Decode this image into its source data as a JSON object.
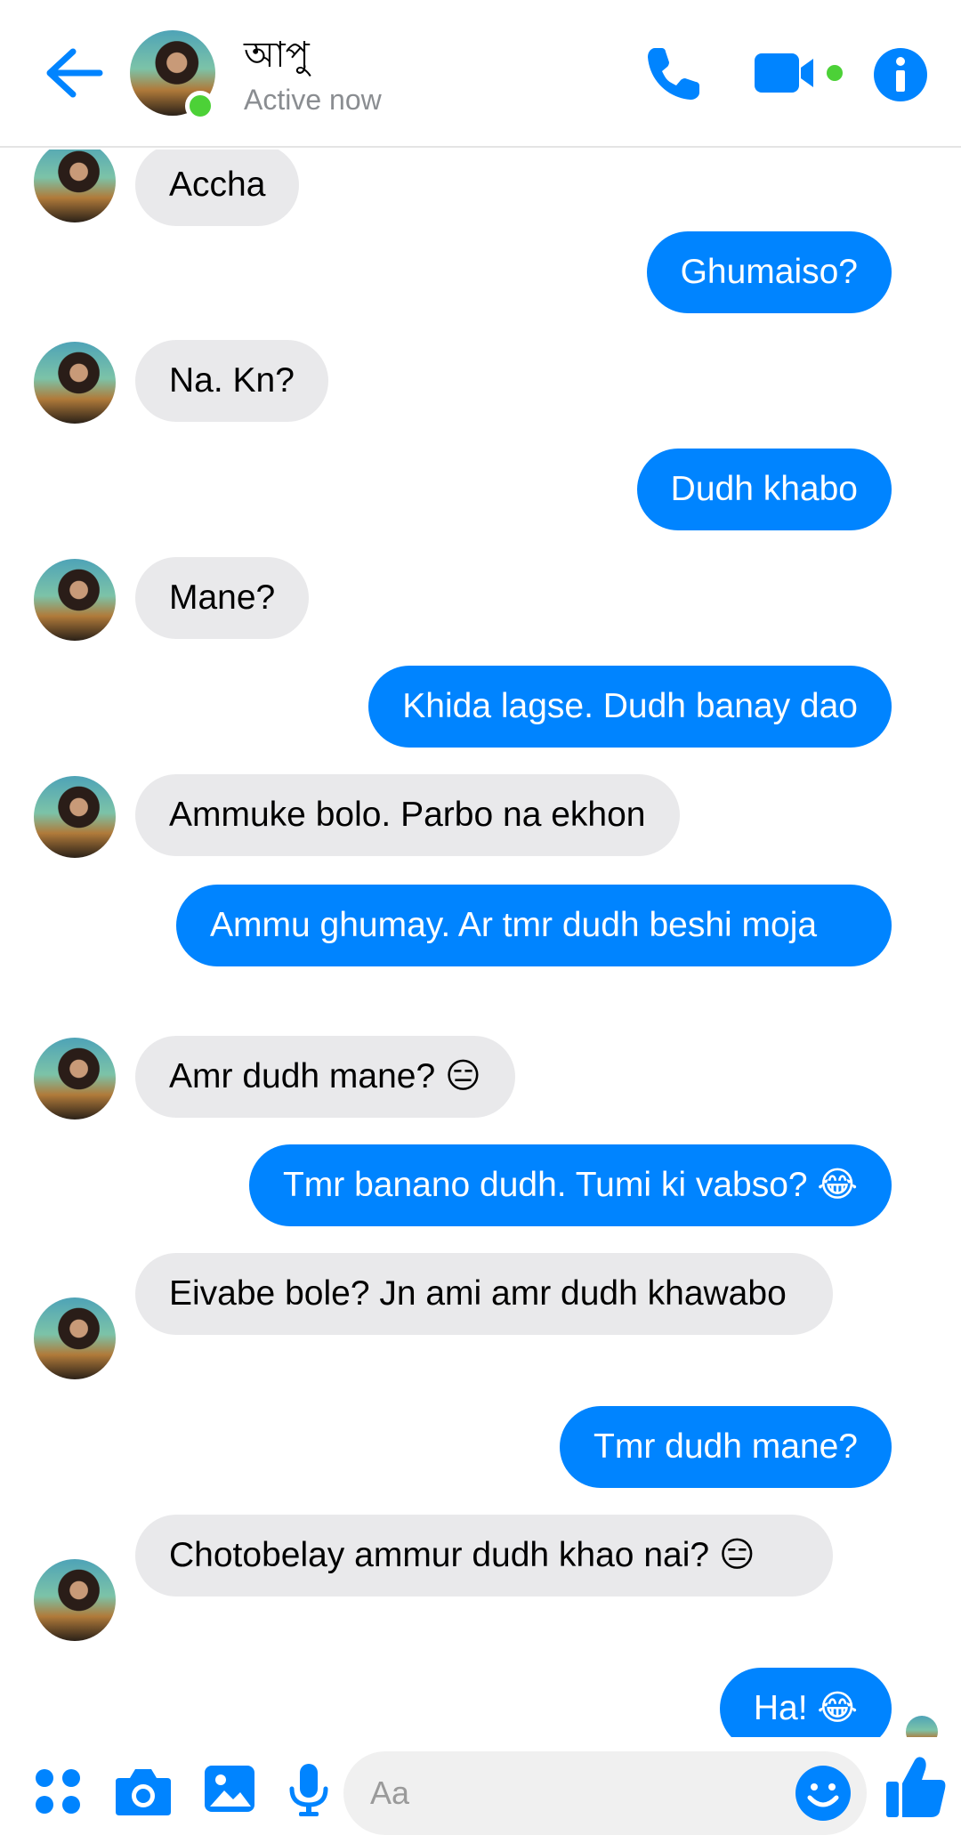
{
  "header": {
    "contact_name": "আপু",
    "status": "Active now"
  },
  "composer": {
    "placeholder": "Aa"
  },
  "messages": [
    {
      "from": "them",
      "text": "Accha"
    },
    {
      "from": "me",
      "text": "Ghumaiso?"
    },
    {
      "from": "them",
      "text": "Na. Kn?"
    },
    {
      "from": "me",
      "text": "Dudh khabo"
    },
    {
      "from": "them",
      "text": "Mane?"
    },
    {
      "from": "me",
      "text": "Khida lagse. Dudh banay dao"
    },
    {
      "from": "them",
      "text": "Ammuke bolo. Parbo na ekhon"
    },
    {
      "from": "me",
      "text": "Ammu ghumay. Ar tmr dudh beshi moja"
    },
    {
      "from": "them",
      "text": "Amr dudh mane? 😑"
    },
    {
      "from": "me",
      "text": "Tmr banano dudh. Tumi ki vabso? 😂"
    },
    {
      "from": "them",
      "text": "Eivabe bole? Jn ami amr dudh khawabo"
    },
    {
      "from": "me",
      "text": "Tmr dudh mane?"
    },
    {
      "from": "them",
      "text": "Chotobelay ammur dudh khao nai? 😑"
    },
    {
      "from": "me",
      "text": "Ha! 😂"
    }
  ],
  "colors": {
    "accent": "#0084ff",
    "incoming_bubble": "#e9e9eb",
    "online": "#4cd137"
  },
  "icons": [
    "back-arrow-icon",
    "phone-icon",
    "video-camera-icon",
    "info-icon",
    "apps-icon",
    "camera-icon",
    "image-icon",
    "microphone-icon",
    "emoji-icon",
    "thumbs-up-icon"
  ]
}
